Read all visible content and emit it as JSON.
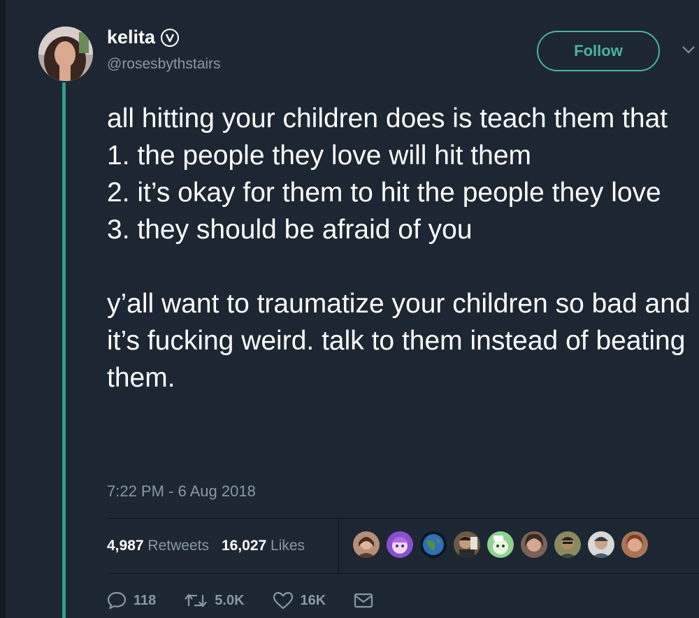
{
  "user": {
    "display_name": "kelita",
    "handle": "@rosesbythstairs"
  },
  "follow_label": "Follow",
  "tweet": {
    "text": "all hitting your children does is teach them that\n1. the people they love will hit them\n2. it’s okay for them to hit the people they love\n3. they should be afraid of you\n\ny’all want to traumatize your children so bad and it’s fucking weird. talk to them instead of beating them.",
    "timestamp": "7:22 PM - 6 Aug 2018"
  },
  "stats": {
    "retweets_count": "4,987",
    "retweets_label": "Retweets",
    "likes_count": "16,027",
    "likes_label": "Likes"
  },
  "actions": {
    "replies": "118",
    "retweets": "5.0K",
    "likes": "16K"
  },
  "colors": {
    "background": "#1c2733",
    "accent": "#4ab3a0",
    "thread_line": "#2ca087",
    "muted_text": "#8899a6"
  },
  "icons": [
    "verified-icon",
    "chevron-down-icon",
    "reply-icon",
    "retweet-icon",
    "like-icon",
    "direct-message-icon"
  ]
}
